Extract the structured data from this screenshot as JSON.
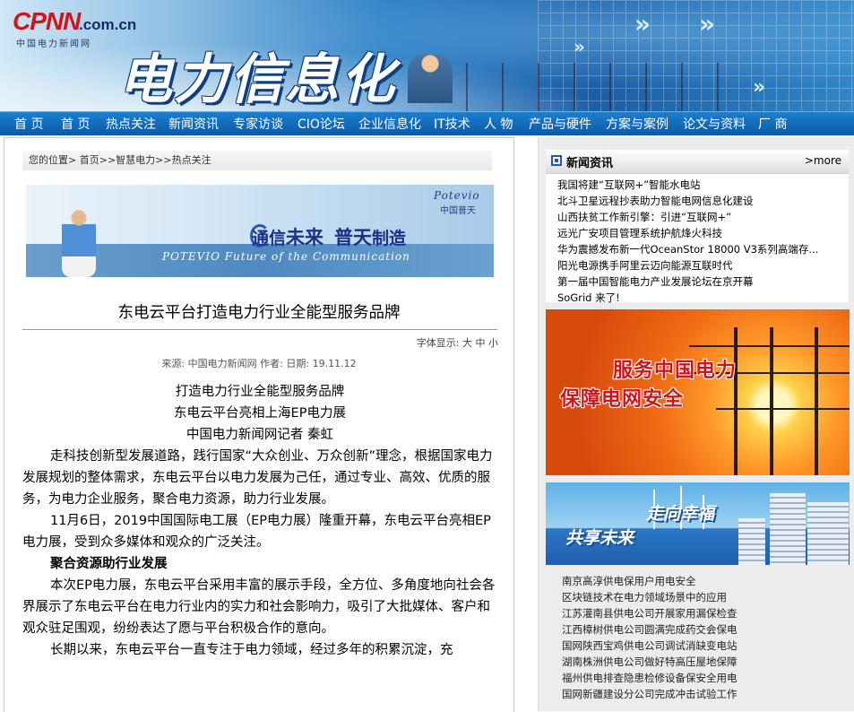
{
  "site": {
    "logo_text": "CPNN",
    "logo_domain": ".com.cn",
    "logo_sub": "中国电力新闻网",
    "banner_title": "电力信息化"
  },
  "nav": [
    "首 页",
    "首 页",
    "热点关注",
    "新闻资讯",
    "专家访谈",
    "CIO论坛",
    "企业信息化",
    "IT技术",
    "人 物",
    "产品与硬件",
    "方案与案例",
    "论文与资料",
    "厂 商"
  ],
  "breadcrumb": {
    "prefix": "您的位置>",
    "items": [
      "首页>",
      ">智慧电力>",
      ">热点关注"
    ]
  },
  "ad": {
    "brand_en": "Potevio",
    "brand_cn": "中国普天",
    "slogan_a": "通信",
    "slogan_b": "未来",
    "slogan_c": "普天",
    "slogan_d": "制造",
    "slogan_en": "POTEVIO Future of the Communication"
  },
  "article": {
    "title": "东电云平台打造电力行业全能型服务品牌",
    "font_label": "字体显示:",
    "font_big": "大",
    "font_mid": "中",
    "font_small": "小",
    "meta_source_label": "来源:",
    "meta_source": "中国电力新闻网",
    "meta_author_label": "作者:",
    "meta_date_label": "日期:",
    "meta_date": "19.11.12",
    "sub1": "打造电力行业全能型服务品牌",
    "sub2": "东电云平台亮相上海EP电力展",
    "byline": "中国电力新闻网记者 秦虹",
    "p1": "走科技创新型发展道路，践行国家“大众创业、万众创新”理念，根据国家电力发展规划的整体需求，东电云平台以电力发展为己任，通过专业、高效、优质的服务，为电力企业服务，聚合电力资源，助力行业发展。",
    "p2": "11月6日，2019中国国际电工展（EP电力展）隆重开幕，东电云平台亮相EP电力展，受到众多媒体和观众的广泛关注。",
    "h1": "聚合资源助行业发展",
    "p3": "本次EP电力展，东电云平台采用丰富的展示手段，全方位、多角度地向社会各界展示了东电云平台在电力行业内的实力和社会影响力，吸引了大批媒体、客户和观众驻足围观，纷纷表达了愿与平台积极合作的意向。",
    "p4": "长期以来，东电云平台一直专注于电力领域，经过多年的积累沉淀，充"
  },
  "news": {
    "title": "新闻资讯",
    "more": ">more",
    "items": [
      "我国将建“互联网+”智能水电站",
      "北斗卫星远程抄表助力智能电网信息化建设",
      "山西扶贫工作新引擎：引进“互联网+”",
      "远光广安项目管理系统护航烽火科技",
      "华为震撼发布新一代OceanStor 18000 V3系列高端存...",
      "阳光电源携手阿里云迈向能源互联时代",
      "第一届中国智能电力产业发展论坛在京开幕",
      "SoGrid 来了!"
    ]
  },
  "promo1": {
    "line1": "服务中国电力",
    "line2": "保障电网安全"
  },
  "promo2": {
    "line1": "走向幸福",
    "line2": "共享未来"
  },
  "links": [
    "南京高淳供电保用户用电安全",
    "区块链技术在电力领域场景中的应用",
    "江苏灌南县供电公司开展家用漏保检查",
    "江西樟树供电公司圆满完成药交会保电",
    "国网陕西宝鸡供电公司调试消缺变电站",
    "湖南株洲供电公司做好特高压屋地保障",
    "福州供电排查隐患检修设备保安全用电",
    "国网新疆建设分公司完成冲击试验工作"
  ]
}
